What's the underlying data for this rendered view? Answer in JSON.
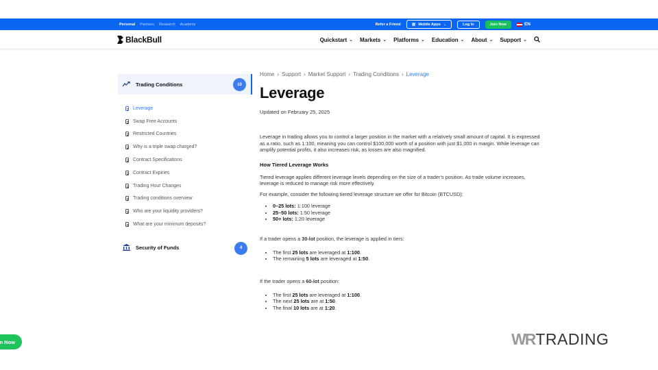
{
  "topbar": {
    "left_links": [
      {
        "label": "Personal",
        "active": true
      },
      {
        "label": "Partners",
        "active": false
      },
      {
        "label": "Research",
        "active": false
      },
      {
        "label": "Academy",
        "active": false
      }
    ],
    "refer_label": "Refer a Friend",
    "mobile_apps_label": "Mobile Apps",
    "login_label": "Log In",
    "join_label": "Join Now",
    "lang_label": "EN"
  },
  "nav": {
    "logo_text": "BlackBull",
    "items": [
      "Quickstart",
      "Markets",
      "Platforms",
      "Education",
      "About",
      "Support"
    ]
  },
  "sidebar": {
    "category1": {
      "label": "Trading Conditions",
      "count": "10"
    },
    "items": [
      {
        "label": "Leverage",
        "active": true
      },
      {
        "label": "Swap Free Accounts",
        "active": false
      },
      {
        "label": "Restricted Countries",
        "active": false
      },
      {
        "label": "Why is a triple swap charged?",
        "active": false
      },
      {
        "label": "Contract Specifications",
        "active": false
      },
      {
        "label": "Contract Expiries",
        "active": false
      },
      {
        "label": "Trading Hour Changes",
        "active": false
      },
      {
        "label": "Trading conditions overview",
        "active": false
      },
      {
        "label": "Who are your liquidity providers?",
        "active": false
      },
      {
        "label": "What are your minimum deposits?",
        "active": false
      }
    ],
    "category2": {
      "label": "Security of Funds",
      "count": "4"
    }
  },
  "breadcrumb": [
    "Home",
    "Support",
    "Market Support",
    "Trading Conditions",
    "Leverage"
  ],
  "article": {
    "title": "Leverage",
    "updated": "Updated on February 25, 2025",
    "intro": "Leverage in trading allows you to control a larger position in the market with a relatively small amount of capital. It is expressed as a ratio, such as 1:100, meaning you can control $100,000 worth of a position with just $1,000 in margin. While leverage can amplify potential profits, it also increases risk, as losses are also magnified.",
    "heading": "How Tiered Leverage Works",
    "tiered_para": "Tiered leverage applies different leverage levels depending on the size of a trader’s position. As trade volume increases, leverage is reduced to manage risk more effectively.",
    "example_para": "For example, consider the following tiered leverage structure we offer for Bitcoin (BTCUSD):",
    "tiers": [
      {
        "lots": "0–25 lots:",
        "rest": " 1:100 leverage"
      },
      {
        "lots": "25–50 lots:",
        "rest": " 1:50 leverage"
      },
      {
        "lots": "50+ lots:",
        "rest": " 1:20 leverage"
      }
    ],
    "example30": {
      "pre": "If a trader opens a ",
      "bold": "30-lot",
      "post": " position, the leverage is applied in tiers:"
    },
    "list30": [
      {
        "a": "The first ",
        "b": "25 lots",
        "c": " are leveraged at ",
        "d": "1:100",
        "e": "."
      },
      {
        "a": "The remaining ",
        "b": "5 lots",
        "c": " are leveraged at ",
        "d": "1:50",
        "e": "."
      }
    ],
    "example60": {
      "pre": "If the trader opens a ",
      "bold": "60-lot",
      "post": " position:"
    },
    "list60": [
      {
        "a": "The first ",
        "b": "25 lots",
        "c": " are leveraged at ",
        "d": "1:100",
        "e": "."
      },
      {
        "a": "The next ",
        "b": "25 lots",
        "c": " are at ",
        "d": "1:50",
        "e": "."
      },
      {
        "a": "The final ",
        "b": "10 lots",
        "c": " are at ",
        "d": "1:20",
        "e": "."
      }
    ]
  },
  "float_button": "n Now",
  "watermark": {
    "mark": "WR",
    "text": "TRADING"
  },
  "colors": {
    "brand_blue": "#0a66f2",
    "join_green": "#17c05a",
    "link_blue": "#3d7cf0"
  }
}
